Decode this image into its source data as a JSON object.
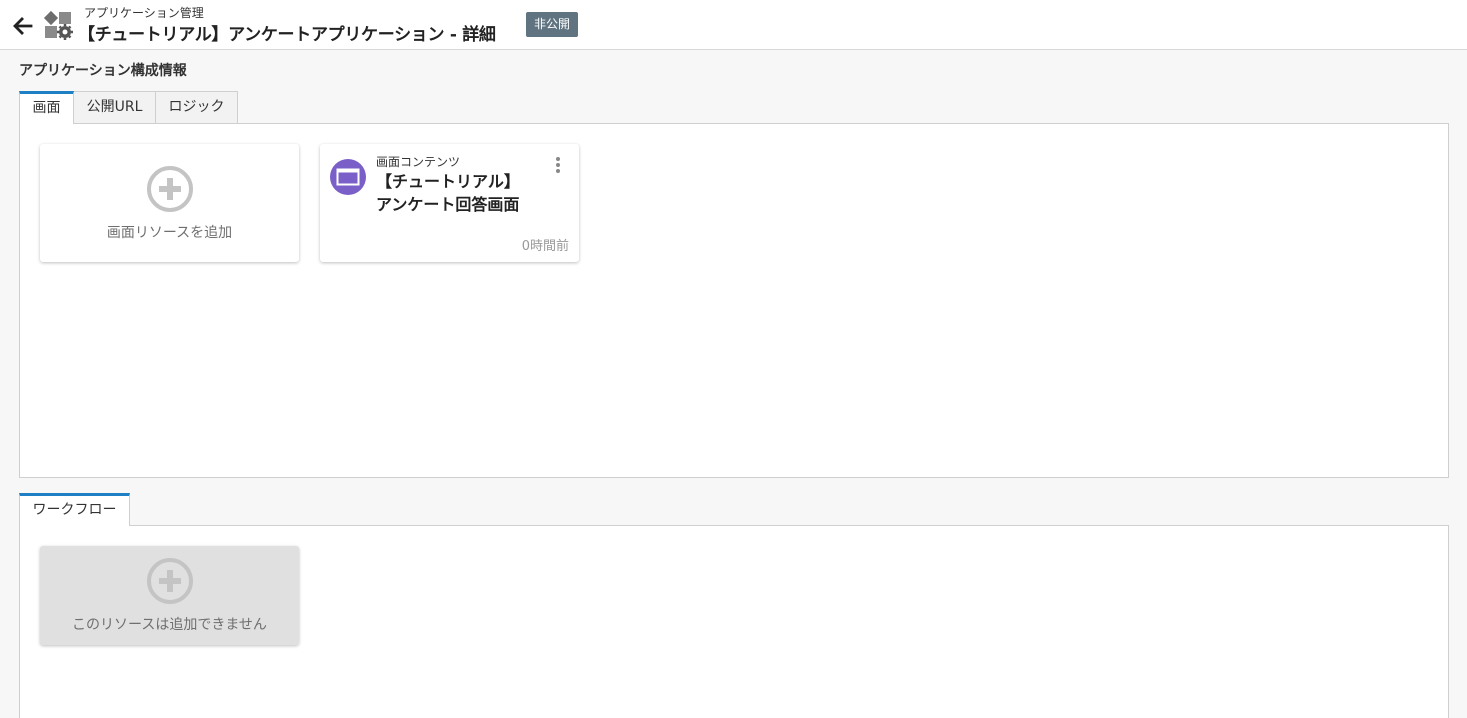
{
  "header": {
    "breadcrumb": "アプリケーション管理",
    "title": "【チュートリアル】アンケートアプリケーション - 詳細",
    "status_badge": "非公開",
    "back_icon": "arrow-left-icon",
    "app_icon": "app-management-gear-icon"
  },
  "config": {
    "section_title": "アプリケーション構成情報",
    "tabs": [
      {
        "label": "画面",
        "active": true
      },
      {
        "label": "公開URL",
        "active": false
      },
      {
        "label": "ロジック",
        "active": false
      }
    ],
    "add_card": {
      "label": "画面リソースを追加",
      "icon": "plus-circle-icon"
    },
    "resource_card": {
      "type_label": "画面コンテンツ",
      "title_line1": "【チュートリアル】",
      "title_line2": "アンケート回答画面",
      "time": "0時間前",
      "icon": "browser-window-icon",
      "icon_color": "#7a5fc8",
      "menu_icon": "more-vertical-icon"
    }
  },
  "workflow": {
    "tabs": [
      {
        "label": "ワークフロー",
        "active": true
      }
    ],
    "add_card": {
      "label": "このリソースは追加できません",
      "icon": "plus-circle-icon",
      "disabled": true
    }
  },
  "colors": {
    "accent": "#1f7fc4",
    "badge": "#5f7380",
    "background": "#f7f7f7"
  }
}
